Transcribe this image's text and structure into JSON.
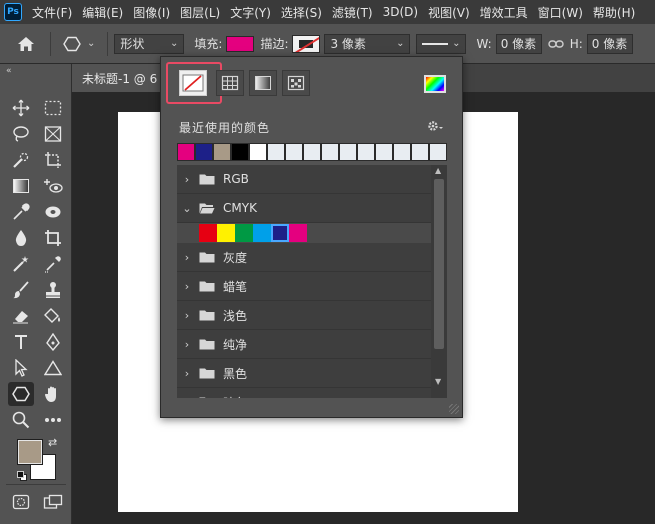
{
  "app": {
    "logo_text": "Ps"
  },
  "menu": [
    "文件(F)",
    "编辑(E)",
    "图像(I)",
    "图层(L)",
    "文字(Y)",
    "选择(S)",
    "滤镜(T)",
    "3D(D)",
    "视图(V)",
    "增效工具",
    "窗口(W)",
    "帮助(H)"
  ],
  "options": {
    "mode_value": "形状",
    "fill_label": "填充:",
    "stroke_label": "描边:",
    "stroke_width_value": "3 像素",
    "w_label": "W:",
    "w_value": "0 像素",
    "h_label": "H:",
    "h_value": "0 像素",
    "fill_color": "#e4007f"
  },
  "document": {
    "tab_title": "未标题-1 @ 6"
  },
  "swatch_panel": {
    "recent_label": "最近使用的颜色",
    "recent_colors": [
      "#e4007f",
      "#1d2088",
      "#a89a87",
      "#000000",
      "#ffffff",
      "#e8edf2",
      "#e8edf2",
      "#e8edf2",
      "#e8edf2",
      "#e8edf2",
      "#e8edf2",
      "#e8edf2",
      "#e8edf2",
      "#e8edf2",
      "#e8edf2"
    ],
    "groups": [
      {
        "name": "RGB",
        "expanded": false
      },
      {
        "name": "CMYK",
        "expanded": true
      },
      {
        "name": "灰度",
        "expanded": false
      },
      {
        "name": "蜡笔",
        "expanded": false
      },
      {
        "name": "浅色",
        "expanded": false
      },
      {
        "name": "纯净",
        "expanded": false
      },
      {
        "name": "黑色",
        "expanded": false
      },
      {
        "name": "暗色",
        "expanded": false
      }
    ],
    "cmyk_colors": [
      "#e60012",
      "#fff100",
      "#009944",
      "#00a0e9",
      "#1d2088",
      "#e4007f"
    ],
    "selected_cmyk_index": 4
  },
  "toolbar": {
    "foreground_color": "#a89a87",
    "background_color": "#ffffff"
  }
}
